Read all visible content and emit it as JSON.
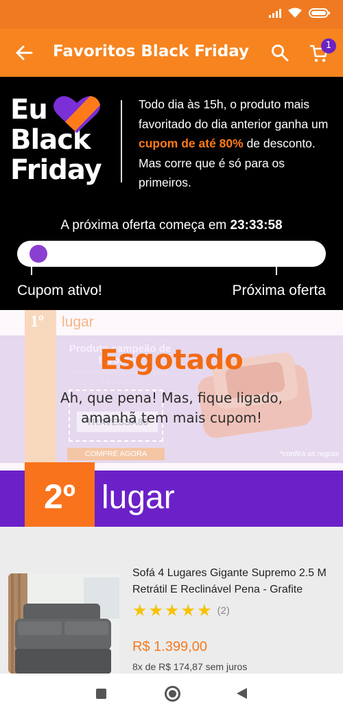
{
  "appbar": {
    "title": "Favoritos Black Friday",
    "cart_count": "1"
  },
  "hero": {
    "brand": [
      "Eu",
      "Black",
      "Friday"
    ],
    "text_before": "Todo dia às 15h, o produto mais favoritado do dia anterior ganha um ",
    "text_highlight": "cupom de até 80%",
    "text_after": " de desconto. Mas corre que é só para os primeiros.",
    "countdown_label": "A próxima oferta começa em ",
    "countdown_time": "23:33:58",
    "progress_fraction": 0.03,
    "label_active": "Cupom ativo!",
    "label_next": "Próxima oferta"
  },
  "first_place": {
    "rank": "1º",
    "rank_label": "lugar",
    "ghost_title": "Produto campeão de favoritos",
    "ghost_subtitle": "Kit de Travessas Retangular La Cuisine",
    "ghost_code": "TRAVESSA80",
    "ghost_button": "COMPRE AGORA",
    "ghost_rules": "*confira as regras",
    "sold_out": "Esgotado",
    "message_line1": "Ah, que pena! Mas, fique ligado,",
    "message_line2": "amanhã tem mais cupom!"
  },
  "second_place": {
    "rank": "2º",
    "rank_label": "lugar"
  },
  "product": {
    "name": "Sofá 4 Lugares Gigante Supremo 2.5 M Retrátil E Reclinável Pena - Grafite",
    "rating": 5,
    "reviews": "(2)",
    "price": "R$ 1.399,00",
    "installments": "8x de R$ 174,87 sem juros"
  },
  "colors": {
    "accent_orange": "#f7841f",
    "accent_purple": "#6b21c7",
    "hero_bg": "#000000",
    "price": "#f47a1e"
  }
}
